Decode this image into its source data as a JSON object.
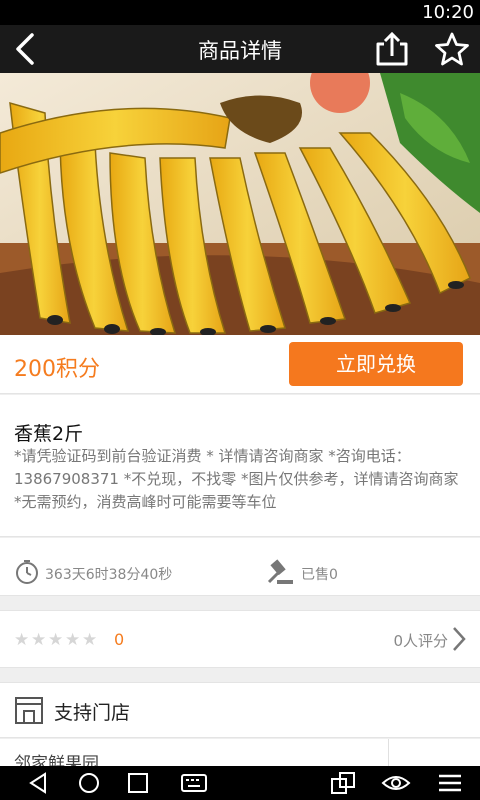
{
  "status_bar": {
    "time": "10:20"
  },
  "header": {
    "title": "商品详情",
    "back_icon": "back-arrow-icon",
    "share_icon": "share-icon",
    "favorite_icon": "star-icon"
  },
  "hero": {
    "subject": "bananas"
  },
  "price": {
    "points": "200积分",
    "redeem_label": "立即兑换",
    "accent": "#f5781e"
  },
  "product": {
    "name": "香蕉2斤",
    "description": "*请凭验证码到前台验证消费 * 详情请咨询商家 *咨询电话：13867908371 *不兑现，不找零 *图片仅供参考，详情请咨询商家 *无需预约，消费高峰时可能需要等车位"
  },
  "meta": {
    "countdown": "363天6时38分40秒",
    "sold": "已售0"
  },
  "rating": {
    "stars_filled": 0,
    "stars_total": 5,
    "score": "0",
    "count_label": "0人评分"
  },
  "store": {
    "title": "支持门店",
    "name": "邻家鲜果园"
  }
}
